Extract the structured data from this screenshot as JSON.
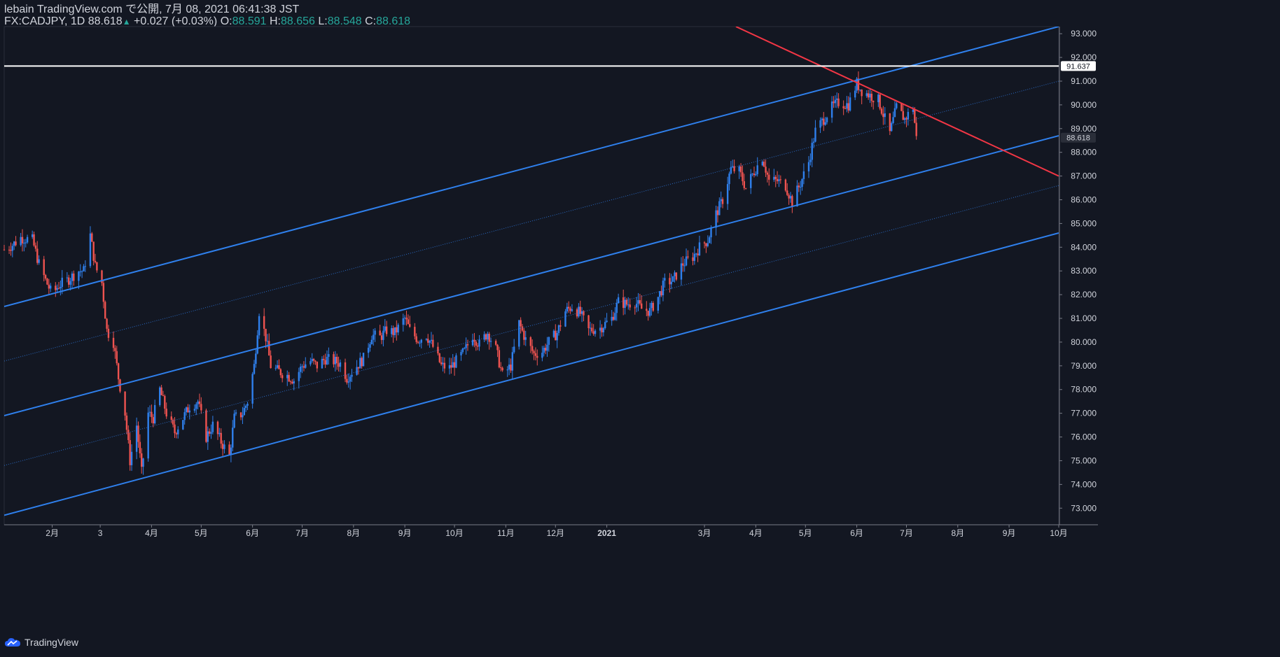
{
  "header": {
    "publish_line": "lebain TradingView.com で公開, 7月 08, 2021 06:41:38 JST",
    "symbol": "FX:CADJPY, 1D",
    "last": "88.618",
    "change": "+0.027 (+0.03%)",
    "o_label": "O:",
    "o_value": "88.591",
    "h_label": "H:",
    "h_value": "88.656",
    "l_label": "L:",
    "l_value": "88.548",
    "c_label": "C:",
    "c_value": "88.618"
  },
  "footer": {
    "brand": "TradingView",
    "logo_icon": "tradingview-cloud-icon"
  },
  "colors": {
    "background": "#131722",
    "up": "#2f80ed",
    "down": "#ef5350",
    "channel": "#2f80ed",
    "trend": "#f23645",
    "hline": "#ffffff",
    "axis_text": "#d1d4dc"
  },
  "chart_data": {
    "type": "candlestick",
    "symbol": "FX:CADJPY",
    "timeframe": "1D",
    "x_range": [
      "2020-01-03",
      "2021-10-01"
    ],
    "ylim": [
      72.3,
      93.3
    ],
    "y_ticks": [
      "73.000",
      "74.000",
      "75.000",
      "76.000",
      "77.000",
      "78.000",
      "79.000",
      "80.000",
      "81.000",
      "82.000",
      "83.000",
      "84.000",
      "85.000",
      "86.000",
      "87.000",
      "88.000",
      "89.000",
      "90.000",
      "91.000",
      "92.000",
      "93.000"
    ],
    "x_ticks": [
      {
        "label": "2月",
        "date": "2020-02-01"
      },
      {
        "label": "3",
        "date": "2020-03-01"
      },
      {
        "label": "4月",
        "date": "2020-04-01"
      },
      {
        "label": "5月",
        "date": "2020-05-01"
      },
      {
        "label": "6月",
        "date": "2020-06-01"
      },
      {
        "label": "7月",
        "date": "2020-07-01"
      },
      {
        "label": "8月",
        "date": "2020-08-01"
      },
      {
        "label": "9月",
        "date": "2020-09-01"
      },
      {
        "label": "10月",
        "date": "2020-10-01"
      },
      {
        "label": "11月",
        "date": "2020-11-01"
      },
      {
        "label": "12月",
        "date": "2020-12-01"
      },
      {
        "label": "2021",
        "date": "2021-01-01"
      },
      {
        "label": "3月",
        "date": "2021-03-01"
      },
      {
        "label": "4月",
        "date": "2021-04-01"
      },
      {
        "label": "5月",
        "date": "2021-05-01"
      },
      {
        "label": "6月",
        "date": "2021-06-01"
      },
      {
        "label": "7月",
        "date": "2021-07-01"
      },
      {
        "label": "8月",
        "date": "2021-08-01"
      },
      {
        "label": "9月",
        "date": "2021-09-01"
      },
      {
        "label": "10月",
        "date": "2021-10-01"
      }
    ],
    "close_path": [
      [
        "2020-01-03",
        83.9
      ],
      [
        "2020-01-08",
        84.1
      ],
      [
        "2020-01-13",
        84.4
      ],
      [
        "2020-01-20",
        84.3
      ],
      [
        "2020-01-24",
        83.3
      ],
      [
        "2020-01-28",
        82.6
      ],
      [
        "2020-02-01",
        82.0
      ],
      [
        "2020-02-05",
        82.4
      ],
      [
        "2020-02-10",
        82.6
      ],
      [
        "2020-02-17",
        83.0
      ],
      [
        "2020-02-20",
        83.0
      ],
      [
        "2020-02-24",
        84.5
      ],
      [
        "2020-02-27",
        83.2
      ],
      [
        "2020-03-02",
        82.5
      ],
      [
        "2020-03-05",
        80.5
      ],
      [
        "2020-03-09",
        80.0
      ],
      [
        "2020-03-12",
        78.5
      ],
      [
        "2020-03-16",
        77.0
      ],
      [
        "2020-03-19",
        75.0
      ],
      [
        "2020-03-23",
        76.5
      ],
      [
        "2020-03-26",
        74.5
      ],
      [
        "2020-03-30",
        77.0
      ],
      [
        "2020-04-02",
        76.8
      ],
      [
        "2020-04-06",
        78.0
      ],
      [
        "2020-04-10",
        77.0
      ],
      [
        "2020-04-15",
        76.2
      ],
      [
        "2020-04-20",
        76.8
      ],
      [
        "2020-04-24",
        77.3
      ],
      [
        "2020-04-29",
        77.5
      ],
      [
        "2020-05-04",
        76.0
      ],
      [
        "2020-05-08",
        76.5
      ],
      [
        "2020-05-13",
        75.8
      ],
      [
        "2020-05-18",
        75.2
      ],
      [
        "2020-05-21",
        76.8
      ],
      [
        "2020-05-26",
        77.0
      ],
      [
        "2020-05-29",
        77.5
      ],
      [
        "2020-06-02",
        79.0
      ],
      [
        "2020-06-05",
        81.3
      ],
      [
        "2020-06-09",
        80.2
      ],
      [
        "2020-06-12",
        79.0
      ],
      [
        "2020-06-16",
        78.8
      ],
      [
        "2020-06-22",
        78.6
      ],
      [
        "2020-06-26",
        78.4
      ],
      [
        "2020-07-01",
        79.0
      ],
      [
        "2020-07-06",
        79.2
      ],
      [
        "2020-07-10",
        79.0
      ],
      [
        "2020-07-15",
        79.3
      ],
      [
        "2020-07-20",
        79.2
      ],
      [
        "2020-07-24",
        79.1
      ],
      [
        "2020-07-28",
        78.5
      ],
      [
        "2020-08-03",
        79.0
      ],
      [
        "2020-08-07",
        79.3
      ],
      [
        "2020-08-12",
        80.3
      ],
      [
        "2020-08-17",
        80.2
      ],
      [
        "2020-08-21",
        80.5
      ],
      [
        "2020-08-26",
        80.4
      ],
      [
        "2020-09-01",
        81.0
      ],
      [
        "2020-09-04",
        80.5
      ],
      [
        "2020-09-09",
        80.1
      ],
      [
        "2020-09-14",
        80.3
      ],
      [
        "2020-09-18",
        79.8
      ],
      [
        "2020-09-23",
        79.0
      ],
      [
        "2020-09-28",
        78.9
      ],
      [
        "2020-10-02",
        79.2
      ],
      [
        "2020-10-07",
        79.6
      ],
      [
        "2020-10-12",
        80.3
      ],
      [
        "2020-10-16",
        79.9
      ],
      [
        "2020-10-21",
        80.4
      ],
      [
        "2020-10-26",
        79.7
      ],
      [
        "2020-10-30",
        78.6
      ],
      [
        "2020-11-04",
        79.0
      ],
      [
        "2020-11-09",
        80.8
      ],
      [
        "2020-11-13",
        80.1
      ],
      [
        "2020-11-18",
        79.5
      ],
      [
        "2020-11-23",
        79.6
      ],
      [
        "2020-11-27",
        80.0
      ],
      [
        "2020-12-02",
        80.4
      ],
      [
        "2020-12-07",
        81.3
      ],
      [
        "2020-12-11",
        81.5
      ],
      [
        "2020-12-16",
        81.2
      ],
      [
        "2020-12-21",
        80.5
      ],
      [
        "2020-12-28",
        80.6
      ],
      [
        "2021-01-04",
        81.0
      ],
      [
        "2021-01-08",
        81.7
      ],
      [
        "2021-01-13",
        81.6
      ],
      [
        "2021-01-18",
        81.7
      ],
      [
        "2021-01-22",
        81.4
      ],
      [
        "2021-01-27",
        81.3
      ],
      [
        "2021-02-01",
        81.9
      ],
      [
        "2021-02-05",
        82.5
      ],
      [
        "2021-02-10",
        82.6
      ],
      [
        "2021-02-16",
        83.3
      ],
      [
        "2021-02-22",
        83.6
      ],
      [
        "2021-02-26",
        84.0
      ],
      [
        "2021-03-03",
        84.3
      ],
      [
        "2021-03-08",
        85.4
      ],
      [
        "2021-03-12",
        86.0
      ],
      [
        "2021-03-17",
        87.3
      ],
      [
        "2021-03-22",
        87.2
      ],
      [
        "2021-03-26",
        86.5
      ],
      [
        "2021-03-31",
        87.2
      ],
      [
        "2021-04-05",
        87.8
      ],
      [
        "2021-04-09",
        86.8
      ],
      [
        "2021-04-14",
        86.8
      ],
      [
        "2021-04-19",
        86.6
      ],
      [
        "2021-04-23",
        85.9
      ],
      [
        "2021-04-28",
        86.7
      ],
      [
        "2021-05-03",
        87.6
      ],
      [
        "2021-05-07",
        88.9
      ],
      [
        "2021-05-12",
        89.4
      ],
      [
        "2021-05-17",
        89.9
      ],
      [
        "2021-05-21",
        90.1
      ],
      [
        "2021-05-27",
        90.0
      ],
      [
        "2021-06-01",
        90.9
      ],
      [
        "2021-06-04",
        90.6
      ],
      [
        "2021-06-09",
        90.4
      ],
      [
        "2021-06-14",
        90.2
      ],
      [
        "2021-06-17",
        89.6
      ],
      [
        "2021-06-21",
        88.8
      ],
      [
        "2021-06-25",
        89.9
      ],
      [
        "2021-06-30",
        89.4
      ],
      [
        "2021-07-02",
        89.6
      ],
      [
        "2021-07-05",
        89.9
      ],
      [
        "2021-07-07",
        88.6
      ]
    ],
    "drawings": {
      "horizontal_line": {
        "value": 91.637,
        "label": "91.637"
      },
      "last_price_label": "88.618",
      "channel_lines": [
        {
          "name": "upper",
          "style": "solid",
          "start": [
            "2020-01-03",
            81.5
          ],
          "end": [
            "2021-10-01",
            93.3
          ]
        },
        {
          "name": "middle",
          "style": "solid",
          "start": [
            "2020-01-03",
            76.9
          ],
          "end": [
            "2021-10-01",
            88.7
          ]
        },
        {
          "name": "lower",
          "style": "solid",
          "start": [
            "2020-01-03",
            72.7
          ],
          "end": [
            "2021-10-01",
            84.6
          ]
        },
        {
          "name": "upper-mid",
          "style": "dotted",
          "start": [
            "2020-01-03",
            79.2
          ],
          "end": [
            "2021-10-01",
            91.0
          ]
        },
        {
          "name": "lower-mid",
          "style": "dotted",
          "start": [
            "2020-01-03",
            74.8
          ],
          "end": [
            "2021-10-01",
            86.6
          ]
        }
      ],
      "trend_line": {
        "style": "solid",
        "start": [
          "2021-03-20",
          93.3
        ],
        "end": [
          "2021-10-01",
          87.0
        ]
      }
    }
  }
}
